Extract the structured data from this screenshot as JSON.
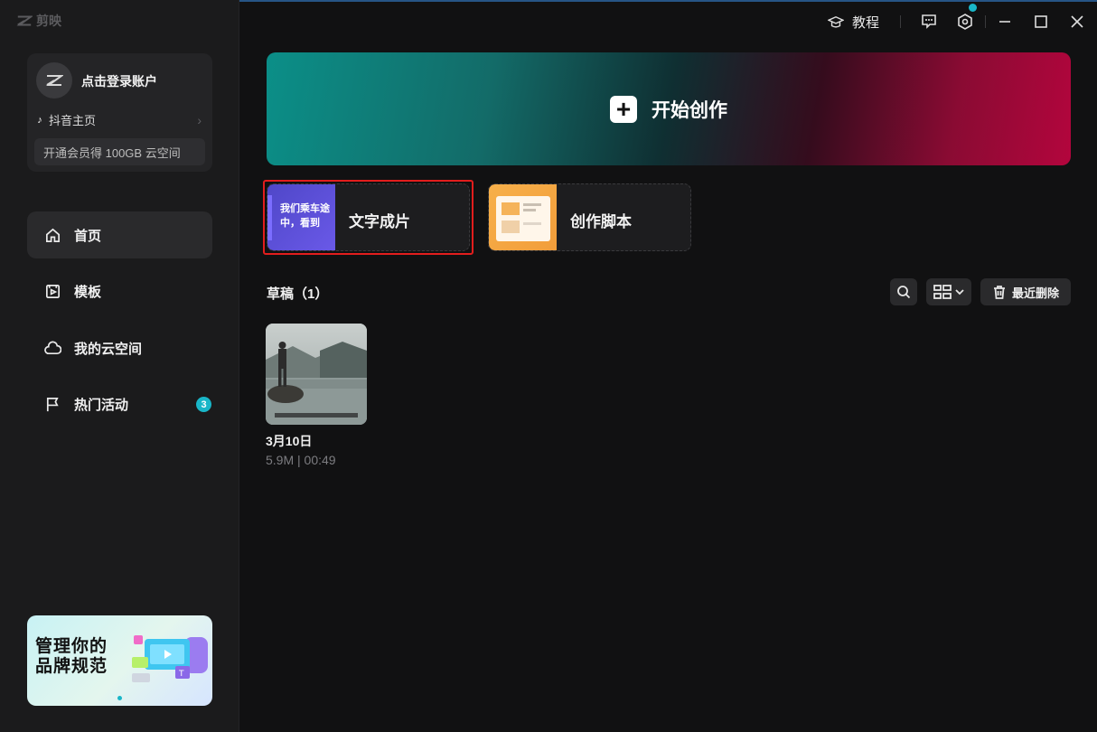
{
  "app": {
    "name": "剪映"
  },
  "account": {
    "login_label": "点击登录账户",
    "douyin_label": "抖音主页",
    "vip_label": "开通会员得 100GB 云空间"
  },
  "nav": {
    "items": [
      {
        "label": "首页",
        "icon": "home-icon",
        "active": true
      },
      {
        "label": "模板",
        "icon": "template-icon",
        "active": false
      },
      {
        "label": "我的云空间",
        "icon": "cloud-icon",
        "active": false
      },
      {
        "label": "热门活动",
        "icon": "flag-icon",
        "active": false,
        "badge": "3"
      }
    ]
  },
  "promo": {
    "line1": "管理你的",
    "line2": "品牌规范"
  },
  "titlebar": {
    "tutorial_label": "教程"
  },
  "hero": {
    "label": "开始创作"
  },
  "features": {
    "text_to_video": {
      "label": "文字成片",
      "thumb_text_line1": "我们乘车途",
      "thumb_text_line2": "中，看到"
    },
    "script": {
      "label": "创作脚本"
    }
  },
  "drafts": {
    "title": "草稿（1）",
    "trash_label": "最近删除",
    "items": [
      {
        "name": "3月10日",
        "meta": "5.9M | 00:49"
      }
    ]
  },
  "colors": {
    "accent": "#19b6c8",
    "highlight": "#e21d1d",
    "hero_left": "#0b8f88",
    "hero_right": "#b3053d"
  }
}
